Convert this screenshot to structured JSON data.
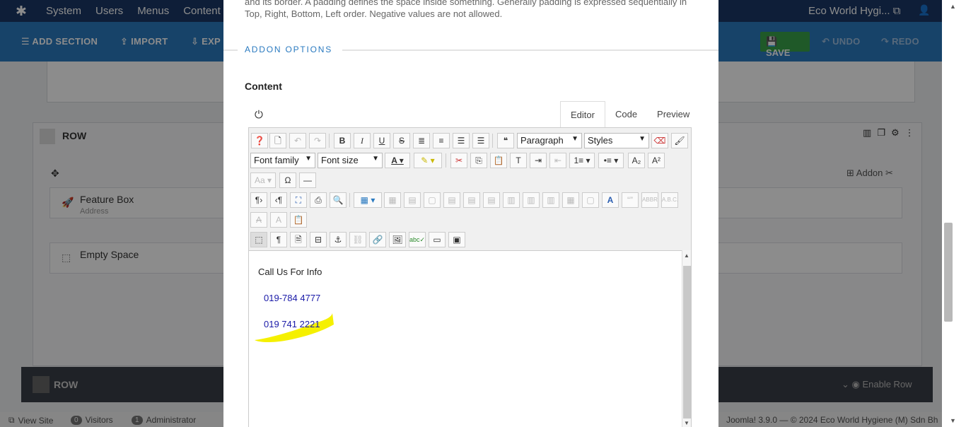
{
  "topbar": {
    "logo_icon": "joomla-logo",
    "menu": [
      "System",
      "Users",
      "Menus",
      "Content"
    ],
    "site_name": "Eco World Hygi...",
    "user_icon": "user-icon"
  },
  "toolbar": {
    "add_section": "ADD SECTION",
    "import": "IMPORT",
    "export": "EXP",
    "save": "SAVE",
    "undo": "UNDO",
    "redo": "REDO"
  },
  "builder": {
    "row_title": "ROW",
    "addon_link": "Addon",
    "addons": [
      {
        "title": "Feature Box",
        "subtitle": "Address"
      },
      {
        "title": "Empty Space",
        "subtitle": ""
      }
    ],
    "row2_title": "ROW",
    "enable_row": "Enable Row"
  },
  "statusbar": {
    "view_site": "View Site",
    "visitors_count": "0",
    "visitors": "Visitors",
    "admin_count": "1",
    "administrator": "Administrator",
    "version": "Joomla! 3.9.0 — © 2024 Eco World Hygiene (M) Sdn Bh"
  },
  "modal": {
    "help_text": "and its border. A padding defines the space inside something. Generally padding is expressed sequentially in Top, Right, Bottom, Left order. Negative values are not allowed.",
    "section_label": "ADDON OPTIONS",
    "content_label": "Content",
    "tabs": [
      "Editor",
      "Code",
      "Preview"
    ],
    "active_tab": "Editor",
    "toolbar": {
      "format_select": "Paragraph",
      "styles_select": "Styles",
      "font_family": "Font family",
      "font_size": "Font size"
    },
    "editor_content": {
      "heading": "Call Us For Info",
      "phones": [
        "019-784 4777",
        "019 741 2221"
      ]
    },
    "highlight_color": "#f5f000"
  }
}
